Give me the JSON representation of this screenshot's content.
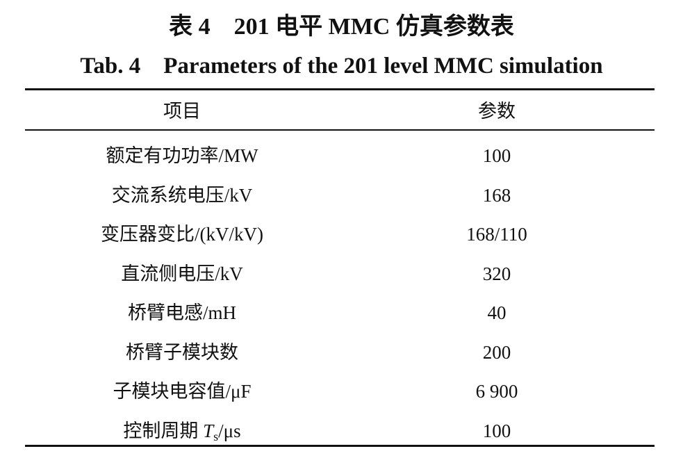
{
  "title_cn": "表 4    201 电平 MMC 仿真参数表",
  "title_en": "Tab. 4    Parameters of the 201 level MMC simulation",
  "columns": [
    "项目",
    "参数"
  ],
  "rows": [
    {
      "item": "额定有功功率/MW",
      "value": "100"
    },
    {
      "item": "交流系统电压/kV",
      "value": "168"
    },
    {
      "item": "变压器变比/(kV/kV)",
      "value": "168/110"
    },
    {
      "item": "直流侧电压/kV",
      "value": "320"
    },
    {
      "item": "桥臂电感/mH",
      "value": "40"
    },
    {
      "item": "桥臂子模块数",
      "value": "200"
    },
    {
      "item": "子模块电容值/μF",
      "value": "6 900"
    },
    {
      "item": "控制周期 ",
      "item_symbol": "T",
      "item_subscript": "s",
      "item_unit": "/μs",
      "value": "100"
    }
  ]
}
